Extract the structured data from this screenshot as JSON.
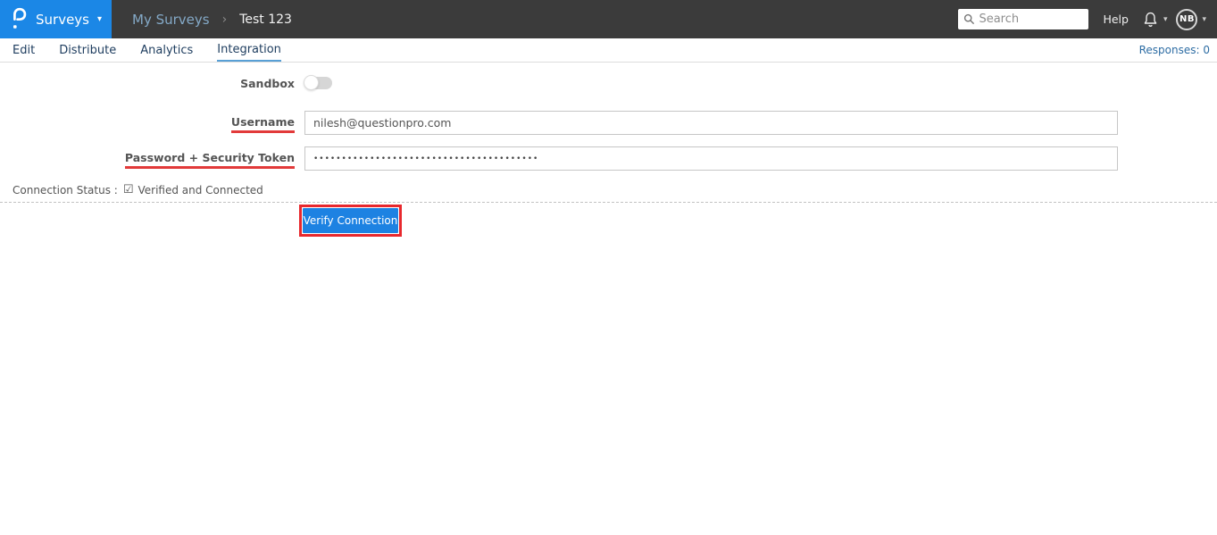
{
  "colors": {
    "brand_blue": "#1b87e6",
    "topbar_dark": "#3b3b3b",
    "button_blue": "#1d82e2",
    "annotation_red": "#e8282d",
    "label_underline_red": "#e23a3a",
    "nav_text": "#1d3c5e",
    "responses_blue": "#2e6da4"
  },
  "icons": {
    "caret_glyph": "▾",
    "checked_box_glyph": "☑"
  },
  "topbar": {
    "product_label": "Surveys",
    "breadcrumb": {
      "parent": "My Surveys",
      "separator": "›",
      "current": "Test 123"
    },
    "search": {
      "placeholder": "Search"
    },
    "help_label": "Help",
    "avatar_initials": "NB"
  },
  "nav": {
    "tabs": [
      {
        "label": "Edit",
        "active": false
      },
      {
        "label": "Distribute",
        "active": false
      },
      {
        "label": "Analytics",
        "active": false
      },
      {
        "label": "Integration",
        "active": true
      }
    ],
    "responses_label": "Responses: 0"
  },
  "form": {
    "sandbox_label": "Sandbox",
    "sandbox_state": "off",
    "username_label": "Username",
    "username_value": "nilesh@questionpro.com",
    "password_label": "Password + Security Token",
    "password_value": "••••••••••••••••••••••••••••••••••••••••",
    "connection_status_label": "Connection Status :",
    "connection_status_value": "Verified and Connected",
    "verify_button_label": "Verify Connection"
  }
}
